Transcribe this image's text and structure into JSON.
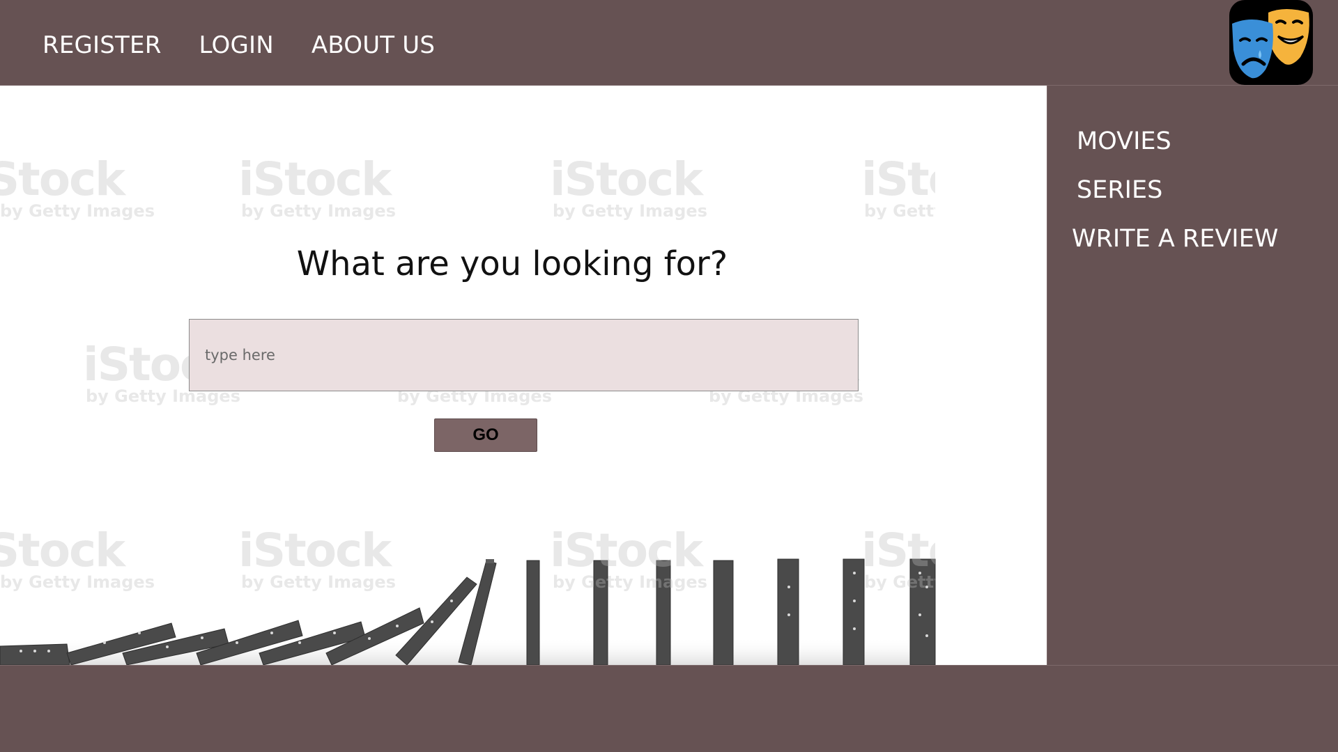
{
  "topnav": {
    "items": [
      {
        "label": "REGISTER"
      },
      {
        "label": "LOGIN"
      },
      {
        "label": "ABOUT US"
      }
    ]
  },
  "logo": {
    "icon": "theater-masks-icon",
    "colors": {
      "sad": "#3a8fd8",
      "happy": "#f5b33c",
      "background": "#000000"
    }
  },
  "sidebar": {
    "items": [
      {
        "label": "MOVIES"
      },
      {
        "label": "SERIES"
      },
      {
        "label": "WRITE A REVIEW"
      }
    ]
  },
  "main": {
    "headline": "What are you looking for?",
    "search": {
      "placeholder": "type here",
      "value": ""
    },
    "go_label": "GO"
  },
  "watermark": {
    "brand": "iStock",
    "byline": "by Getty Images"
  },
  "colors": {
    "bar": "#665253",
    "input_bg": "#ebdfe0",
    "button": "#7c6566"
  }
}
